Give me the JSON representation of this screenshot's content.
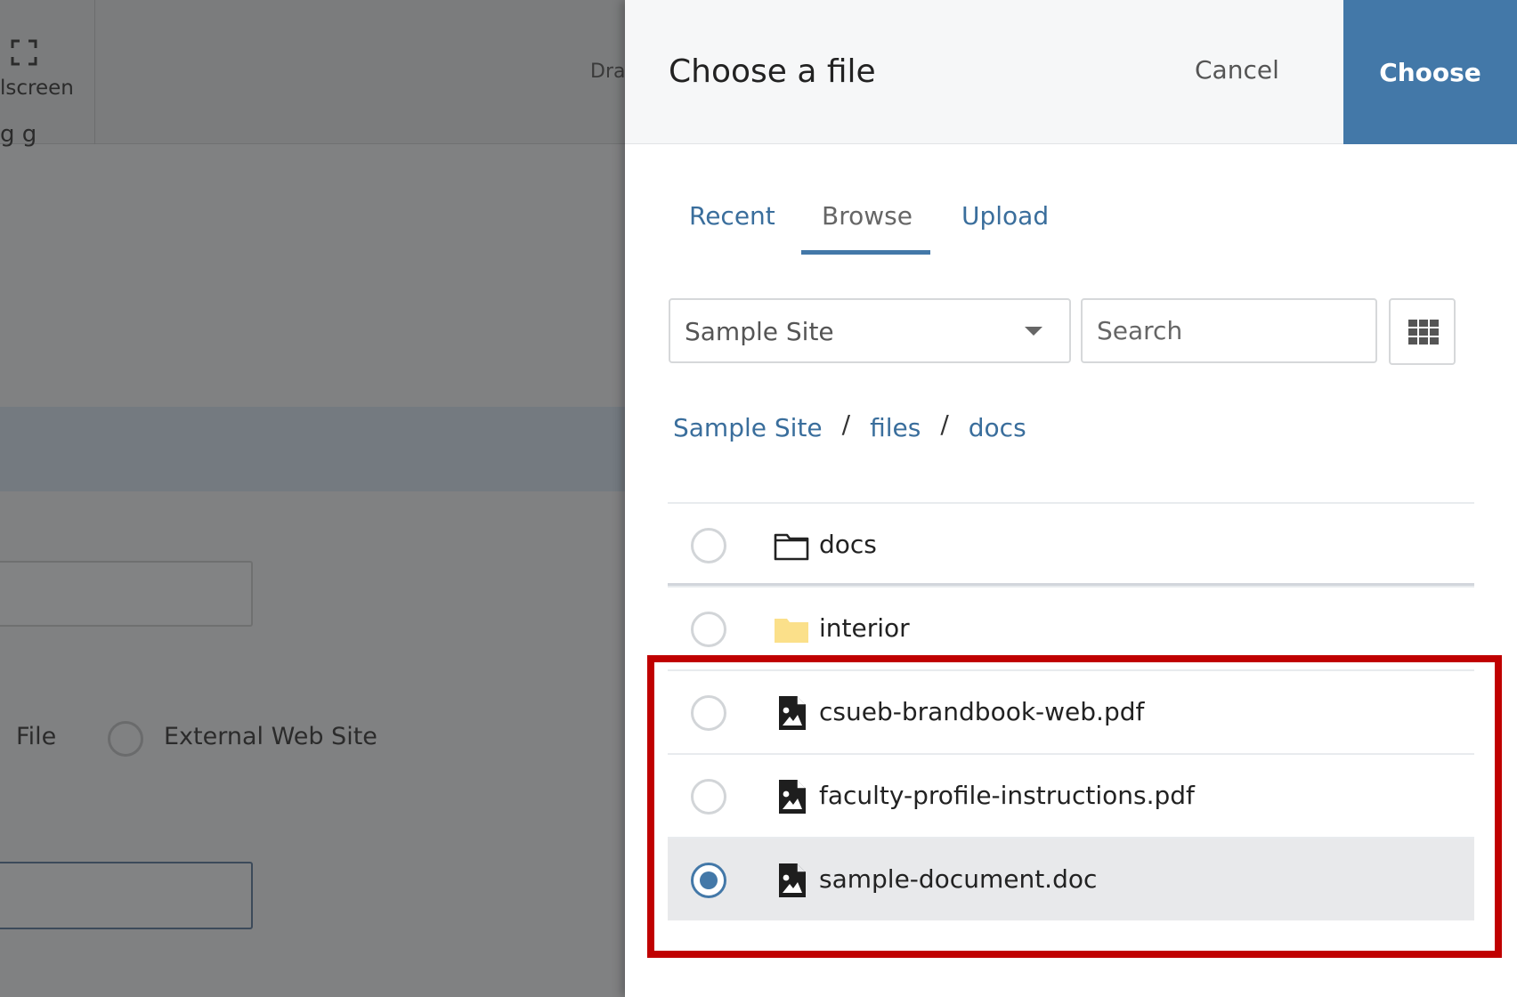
{
  "background": {
    "fullscreen_label": "lscreen",
    "drag_label": "Dra",
    "fragment_text": "g g",
    "link_options": {
      "file_label": "File",
      "external_label": "External Web Site"
    }
  },
  "dialog": {
    "title": "Choose a file",
    "cancel_label": "Cancel",
    "choose_label": "Choose",
    "tabs": [
      {
        "label": "Recent",
        "active": false
      },
      {
        "label": "Browse",
        "active": true
      },
      {
        "label": "Upload",
        "active": false
      }
    ],
    "site_select": {
      "value": "Sample Site"
    },
    "search": {
      "placeholder": "Search",
      "value": ""
    },
    "view_toggle": {
      "icon": "grid-icon"
    },
    "breadcrumb": [
      "Sample Site",
      "files",
      "docs"
    ],
    "breadcrumb_separator": "/",
    "items": [
      {
        "name": "docs",
        "type": "folder-open",
        "selected": false
      },
      {
        "name": "interior",
        "type": "folder",
        "selected": false
      },
      {
        "name": "csueb-brandbook-web.pdf",
        "type": "file",
        "selected": false
      },
      {
        "name": "faculty-profile-instructions.pdf",
        "type": "file",
        "selected": false
      },
      {
        "name": "sample-document.doc",
        "type": "file",
        "selected": true
      }
    ]
  },
  "colors": {
    "accent": "#4378a8",
    "link": "#3a6e9c",
    "folder_yellow": "#fbe08a",
    "annotation": "#c00000",
    "overlay": "#808182"
  }
}
